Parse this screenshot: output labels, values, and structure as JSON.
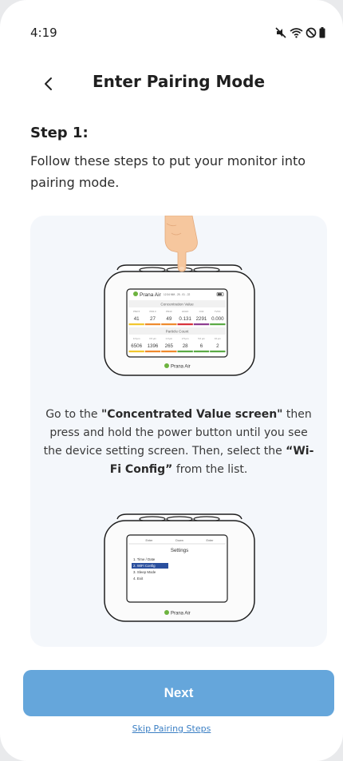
{
  "status": {
    "time": "4:19"
  },
  "header": {
    "title": "Enter Pairing Mode"
  },
  "step": {
    "title": "Step 1:",
    "description": "Follow these steps to put your monitor into pairing mode."
  },
  "instruction": {
    "prefix": "Go to the ",
    "bold1": "\"Concentrated Value screen\"",
    "middle": " then press and hold the power button until you see the device setting screen. Then, select the ",
    "bold2": "“Wi-Fi Config”",
    "suffix": " from the list."
  },
  "device1": {
    "brand": "Prana Air",
    "header_info": "12:34 MM - 25 - 01 - 22",
    "section1": "Concentration Value",
    "row1_labels": [
      "PM2.5",
      "PM1.0",
      "PM10",
      "HCHO",
      "CO2",
      "TVOC"
    ],
    "row1_values": [
      "41",
      "27",
      "49",
      "0.131",
      "2291",
      "0.000"
    ],
    "section2": "Particle Count",
    "row2_labels": [
      "0.3 μm",
      "0.5 μm",
      "1.0 μm",
      "2.5 μm",
      "5.0 μm",
      "10 μm"
    ],
    "row2_values": [
      "6506",
      "1396",
      "265",
      "28",
      "6",
      "2"
    ],
    "footer_brand": "Prana Air"
  },
  "device2": {
    "top_labels": [
      "Enter",
      "Down",
      "Enter"
    ],
    "menu_title": "Settings",
    "menu_items": [
      "1. Time / Date",
      "2. WiFi Config",
      "3. Sleep Mode",
      "4. Exit"
    ],
    "footer_brand": "Prana Air"
  },
  "buttons": {
    "next": "Next",
    "skip": "Skip Pairing Steps"
  },
  "colors": {
    "accent": "#65a6db",
    "link": "#3b7fc4",
    "card_bg": "#f4f7fb",
    "menu_highlight": "#2a4f9e",
    "bar_yellow": "#f2c62e",
    "bar_orange": "#ef8a2c",
    "bar_red": "#d8323a",
    "bar_purple": "#8d3b8f",
    "bar_green": "#5aaa45"
  }
}
